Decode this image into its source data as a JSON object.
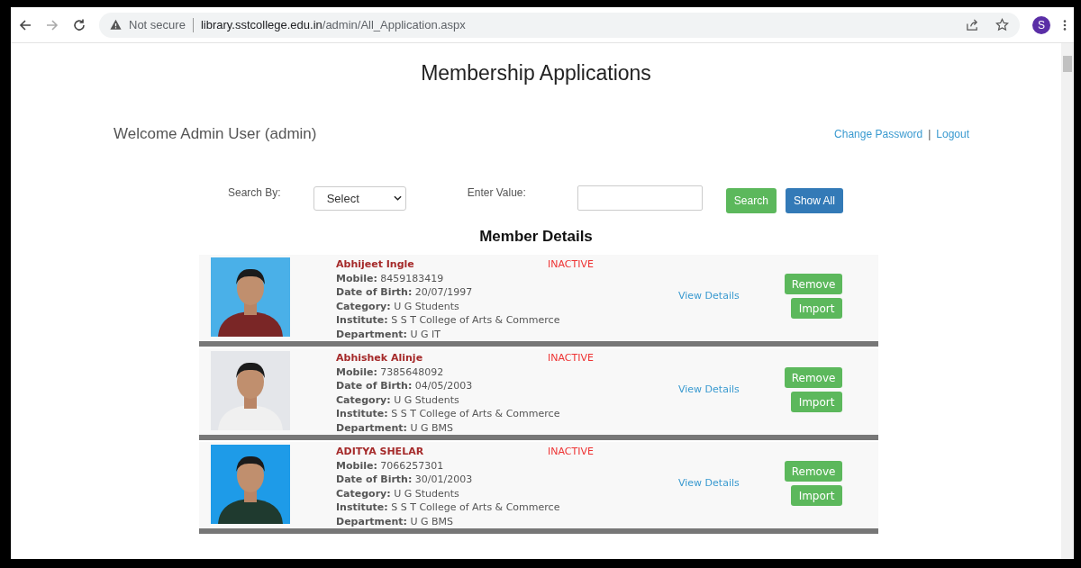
{
  "browser": {
    "security": "Not secure",
    "url_host": "library.sstcollege.edu.in",
    "url_path": "/admin/All_Application.aspx",
    "profile": "S"
  },
  "page": {
    "title": "Membership Applications",
    "welcome": "Welcome Admin User (admin)",
    "links": [
      "Change Password",
      "Logout"
    ],
    "separator": "|"
  },
  "search": {
    "by_label": "Search By:",
    "select_value": "Select",
    "value_label": "Enter Value:",
    "buttons": [
      "Search",
      "Show All"
    ]
  },
  "section_title": "Member Details",
  "members": [
    {
      "name": "Abhijeet Ingle",
      "status": "INACTIVE",
      "fields": [
        {
          "label": "Mobile:",
          "value": "8459183419"
        },
        {
          "label": "Date of Birth:",
          "value": "20/07/1997"
        },
        {
          "label": "Category:",
          "value": "U G Students"
        },
        {
          "label": "Institute:",
          "value": "S S T College of Arts & Commerce"
        },
        {
          "label": "Department:",
          "value": "U G IT"
        }
      ],
      "link": "View Details",
      "actions": [
        "Remove",
        "Import"
      ],
      "photo": {
        "kind": "picture",
        "color": "#4ab0e8"
      }
    },
    {
      "name": "Abhishek Alinje",
      "status": "INACTIVE",
      "fields": [
        {
          "label": "Mobile:",
          "value": "7385648092"
        },
        {
          "label": "Date of Birth:",
          "value": "04/05/2003"
        },
        {
          "label": "Category:",
          "value": "U G Students"
        },
        {
          "label": "Institute:",
          "value": "S S T College of Arts & Commerce"
        },
        {
          "label": "Department:",
          "value": "U G BMS"
        }
      ],
      "link": "View Details",
      "actions": [
        "Remove",
        "Import"
      ],
      "photo": {
        "kind": "picture",
        "color": "#e4e6ea"
      }
    },
    {
      "name": "ADITYA SHELAR",
      "status": "INACTIVE",
      "fields": [
        {
          "label": "Mobile:",
          "value": "7066257301"
        },
        {
          "label": "Date of Birth:",
          "value": "30/01/2003"
        },
        {
          "label": "Category:",
          "value": "U G Students"
        },
        {
          "label": "Institute:",
          "value": "S S T College of Arts & Commerce"
        },
        {
          "label": "Department:",
          "value": "U G BMS"
        }
      ],
      "link": "View Details",
      "actions": [
        "Remove",
        "Import"
      ],
      "photo": {
        "kind": "picture",
        "color": "#1e9be8"
      }
    }
  ]
}
